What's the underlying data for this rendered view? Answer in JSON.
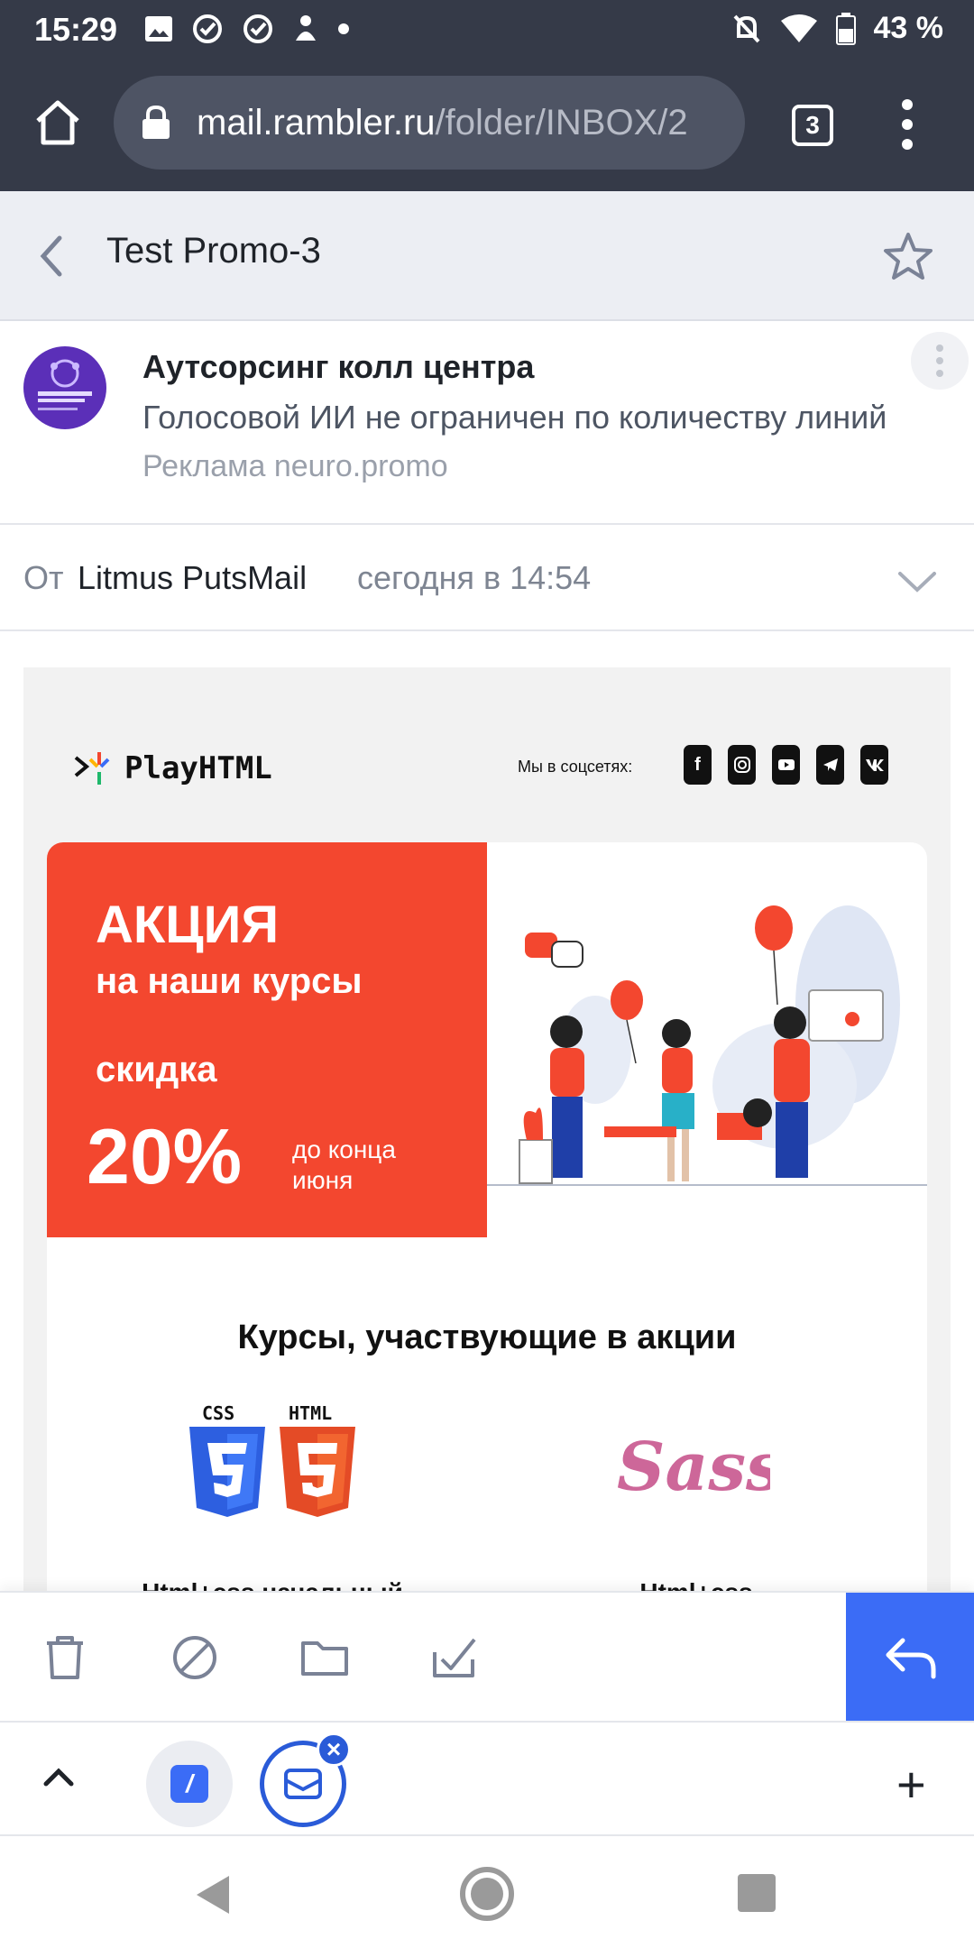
{
  "status_bar": {
    "time": "15:29",
    "battery": "43 %",
    "icons": [
      "image-icon",
      "check-circle-icon",
      "check-circle-icon",
      "notification-icon",
      "dot-icon",
      "mute-icon",
      "wifi-icon",
      "battery-icon"
    ]
  },
  "browser": {
    "url_host": "mail.rambler.ru",
    "url_path": "/folder/INBOX/2",
    "tab_count": "3"
  },
  "mail_header": {
    "title": "Test Promo-3"
  },
  "ad": {
    "title": "Аутсорсинг колл центра",
    "text": "Голосовой ИИ не ограничен по количеству линий",
    "source": "Реклама neuro.promo"
  },
  "from": {
    "label": "От",
    "name": "Litmus PutsMail",
    "date": "сегодня в 14:54"
  },
  "email": {
    "logo_text": "PlayHTML",
    "social_label": "Мы в соцсетях:",
    "socials": [
      "f",
      "ig",
      "yt",
      "tg",
      "vk"
    ],
    "promo": {
      "line1": "АКЦИЯ",
      "line2": "на наши курсы",
      "line3": "скидка",
      "percent": "20%",
      "until": "до конца июня"
    },
    "courses_title": "Курсы, участвующие в акции",
    "courses": [
      {
        "name": "Html+css начальный",
        "badges": [
          "CSS",
          "HTML"
        ]
      },
      {
        "name": "Html+css продвинутый",
        "badges": [
          "Sass"
        ]
      }
    ]
  },
  "colors": {
    "chrome": "#353a48",
    "promo_red": "#f3472f",
    "accent_blue": "#3b6cf6"
  }
}
